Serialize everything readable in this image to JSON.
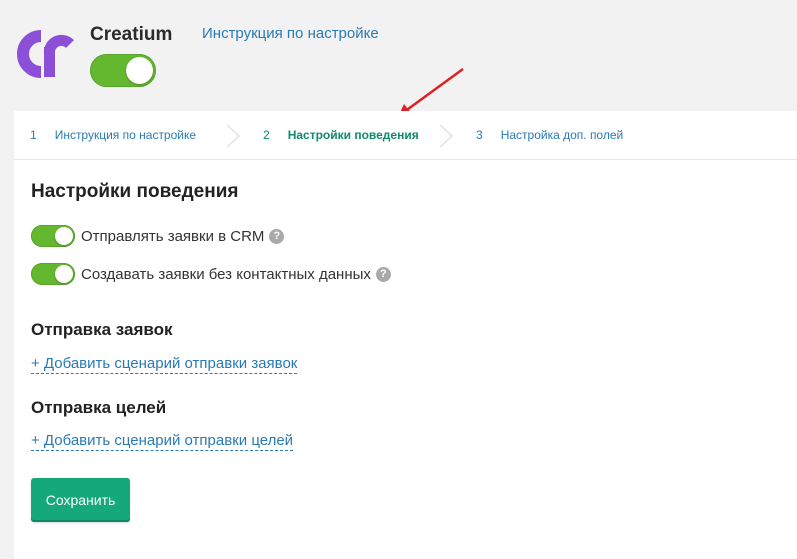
{
  "header": {
    "app_name": "Creatium",
    "instructions_link": "Инструкция по настройке",
    "enabled": true
  },
  "steps": [
    {
      "num": "1",
      "label": "Инструкция по настройке",
      "active": false
    },
    {
      "num": "2",
      "label": "Настройки поведения",
      "active": true
    },
    {
      "num": "3",
      "label": "Настройка доп. полей",
      "active": false
    }
  ],
  "behavior": {
    "title": "Настройки поведения",
    "options": [
      {
        "label": "Отправлять заявки в CRM",
        "enabled": true
      },
      {
        "label": "Создавать заявки без контактных данных",
        "enabled": true
      }
    ]
  },
  "leads": {
    "title": "Отправка заявок",
    "add_link": "+ Добавить сценарий отправки заявок"
  },
  "goals": {
    "title": "Отправка целей",
    "add_link": "+ Добавить сценарий отправки целей"
  },
  "save_button": "Сохранить",
  "help_icon": "?",
  "colors": {
    "brand": "#8c4fd8",
    "toggle_on": "#64b82f",
    "link": "#2a7ab5",
    "active_step": "#0f8a6a",
    "save_button": "#15a97a",
    "annotation_arrow": "#e02020"
  }
}
